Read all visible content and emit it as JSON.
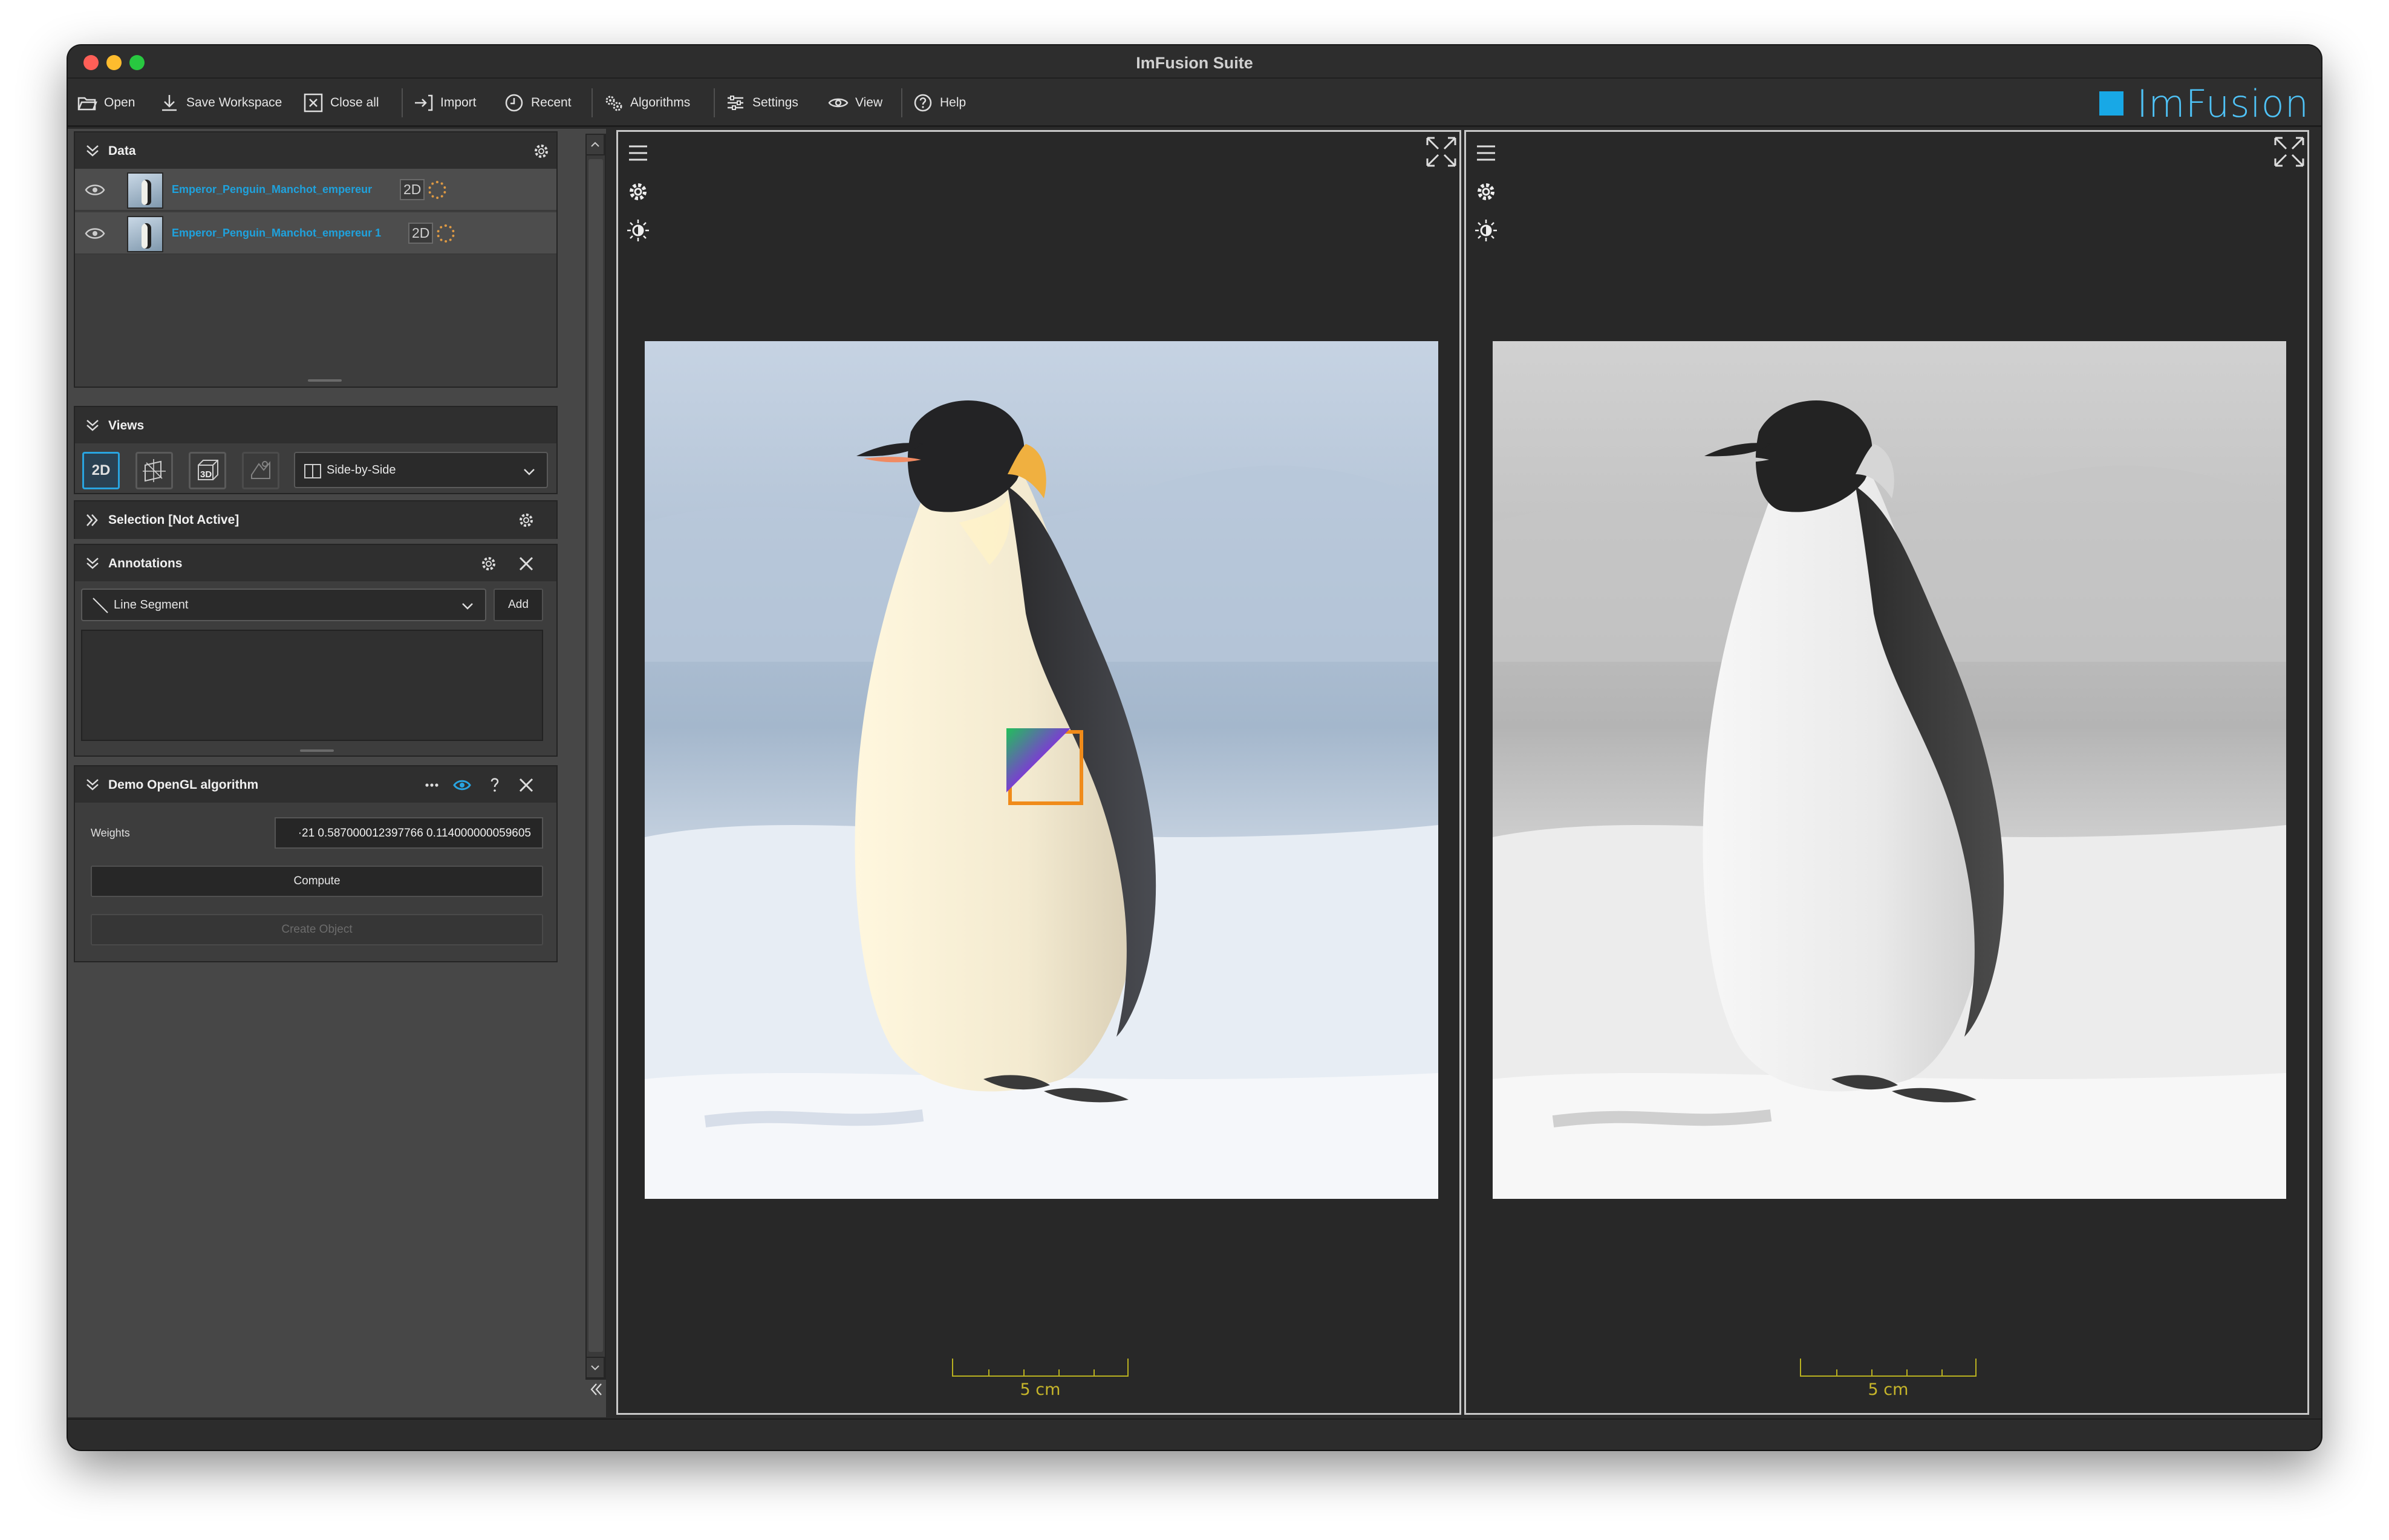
{
  "window": {
    "title": "ImFusion Suite"
  },
  "toolbar": {
    "open": "Open",
    "save_workspace": "Save Workspace",
    "close_all": "Close all",
    "import": "Import",
    "recent": "Recent",
    "algorithms": "Algorithms",
    "settings": "Settings",
    "view": "View",
    "help": "Help",
    "logo_text": "ImFusion"
  },
  "data_panel": {
    "title": "Data",
    "items": [
      {
        "name": "Emperor_Penguin_Manchot_empereur",
        "badge": "2D"
      },
      {
        "name": "Emperor_Penguin_Manchot_empereur 1",
        "badge": "2D"
      }
    ]
  },
  "views_panel": {
    "title": "Views",
    "buttons": [
      "2D",
      "MPR",
      "3D",
      "Render"
    ],
    "layout": "Side-by-Side"
  },
  "selection_panel": {
    "title": "Selection [Not Active]"
  },
  "annotations_panel": {
    "title": "Annotations",
    "tool": "Line Segment",
    "add_label": "Add"
  },
  "algorithm_panel": {
    "title": "Demo OpenGL algorithm",
    "weights_label": "Weights",
    "weights_value": "·21 0.587000012397766 0.114000000059605",
    "compute_label": "Compute",
    "create_object_label": "Create Object"
  },
  "viewports": [
    {
      "scale_label": "5 cm",
      "mode": "color"
    },
    {
      "scale_label": "5 cm",
      "mode": "grayscale"
    }
  ],
  "colors": {
    "accent": "#29a4e0",
    "dataset_link": "#1fa2dd",
    "scale_bar": "#c7b62a",
    "logo": "#18a8e6"
  }
}
